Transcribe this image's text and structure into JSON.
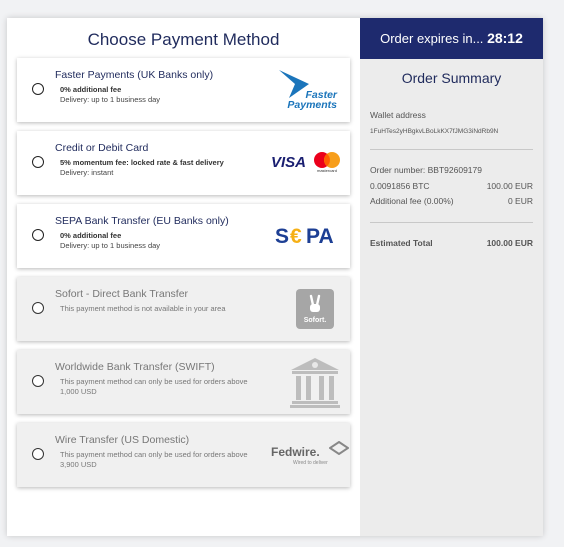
{
  "page_title": "Choose Payment Method",
  "methods": [
    {
      "title": "Faster Payments (UK Banks only)",
      "fee": "0% additional fee",
      "delivery": "Delivery: up to 1 business day",
      "logo": "Faster Payments"
    },
    {
      "title": "Credit or Debit Card",
      "fee": "5% momentum fee: locked rate & fast delivery",
      "delivery": "Delivery: instant",
      "logo": "VISA",
      "logo2": "mastercard"
    },
    {
      "title": "SEPA Bank Transfer (EU Banks only)",
      "fee": "0% additional fee",
      "delivery": "Delivery: up to 1 business day",
      "logo": "SEPA"
    },
    {
      "title": "Sofort - Direct Bank Transfer",
      "note": "This payment method is not available in your area",
      "logo": "Sofort."
    },
    {
      "title": "Worldwide Bank Transfer (SWIFT)",
      "note": "This payment method can only be used for orders above 1,000 USD",
      "logo": "bank-icon"
    },
    {
      "title": "Wire Transfer (US Domestic)",
      "note": "This payment method can only be used for orders above 3,900 USD",
      "logo": "Fedwire.",
      "logo_sub": "Wired to deliver"
    }
  ],
  "order": {
    "expires_label": "Order expires in...",
    "expires_time": "28:12",
    "summary_title": "Order Summary",
    "wallet_label": "Wallet address",
    "wallet_address": "1FuHTes2yHBgkvLBoLkKX7fJMG3iNdRb9N",
    "order_number": "Order number: BBT92609179",
    "btc_amount": "0.0091856 BTC",
    "btc_value": "100.00 EUR",
    "fee_label": "Additional fee (0.00%)",
    "fee_value": "0 EUR",
    "total_label": "Estimated Total",
    "total_value": "100.00 EUR"
  },
  "colors": {
    "primary": "#1e2a6e",
    "faster_blue": "#1b75bb",
    "sepa_blue": "#1d3f94",
    "sepa_yellow": "#f6b015",
    "mc_red": "#eb001b",
    "mc_orange": "#f79e1b"
  }
}
